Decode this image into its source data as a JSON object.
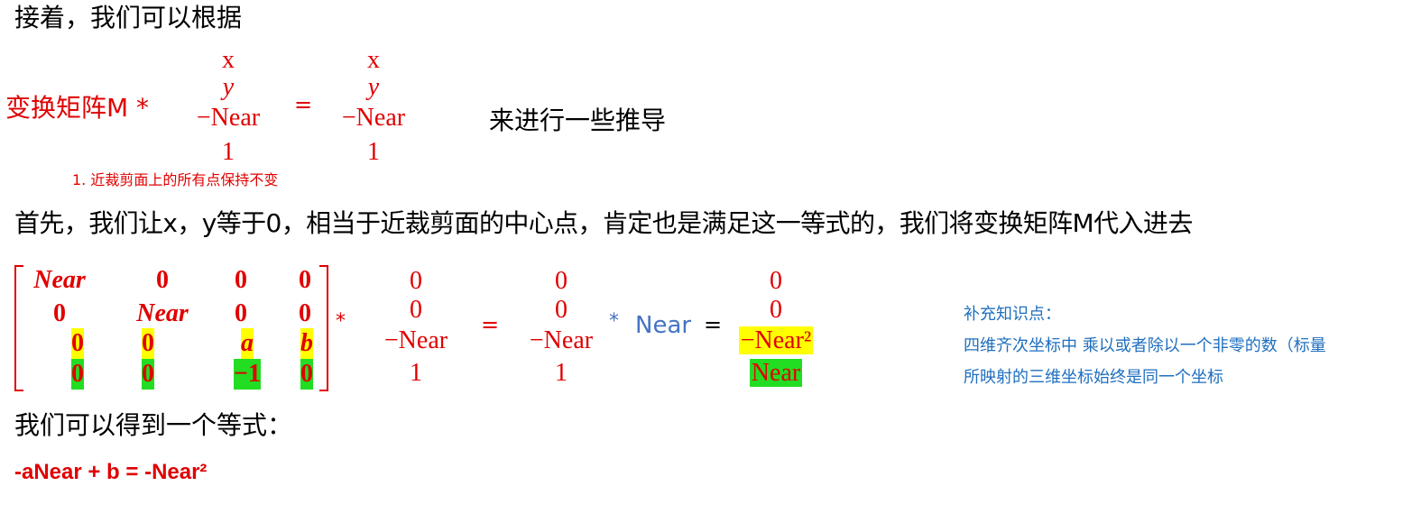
{
  "line1": "接着，我们可以根据",
  "eq1": {
    "lhs_label": "变换矩阵M *",
    "vector_left": [
      "x",
      "y",
      "−Near",
      "1"
    ],
    "equals": "=",
    "vector_right": [
      "x",
      "y",
      "−Near",
      "1"
    ],
    "suffix": "来进行一些推导",
    "note": "1. 近裁剪面上的所有点保持不变"
  },
  "line2": "首先，我们让x，y等于0，相当于近裁剪面的中心点，肯定也是满足这一等式的，我们将变换矩阵M代入进去",
  "matrix": {
    "rows": [
      [
        "Near",
        "0",
        "0",
        "0"
      ],
      [
        "0",
        "Near",
        "0",
        "0"
      ],
      [
        "0",
        "0",
        "a",
        "b"
      ],
      [
        "0",
        "0",
        "−1",
        "0"
      ]
    ],
    "times": "*",
    "vector1": [
      "0",
      "0",
      "−Near",
      "1"
    ],
    "equals": "=",
    "vector2": [
      "0",
      "0",
      "−Near",
      "1"
    ],
    "times2": "*",
    "scalar": "Near",
    "equals2": "=",
    "vector3": [
      "0",
      "0",
      "−Near²",
      "Near"
    ]
  },
  "side_note": {
    "title": "补充知识点：",
    "line1": "四维齐次坐标中 乘以或者除以一个非零的数（标量",
    "line2": "所映射的三维坐标始终是同一个坐标"
  },
  "line3": "我们可以得到一个等式：",
  "result": "-aNear + b = -Near²"
}
